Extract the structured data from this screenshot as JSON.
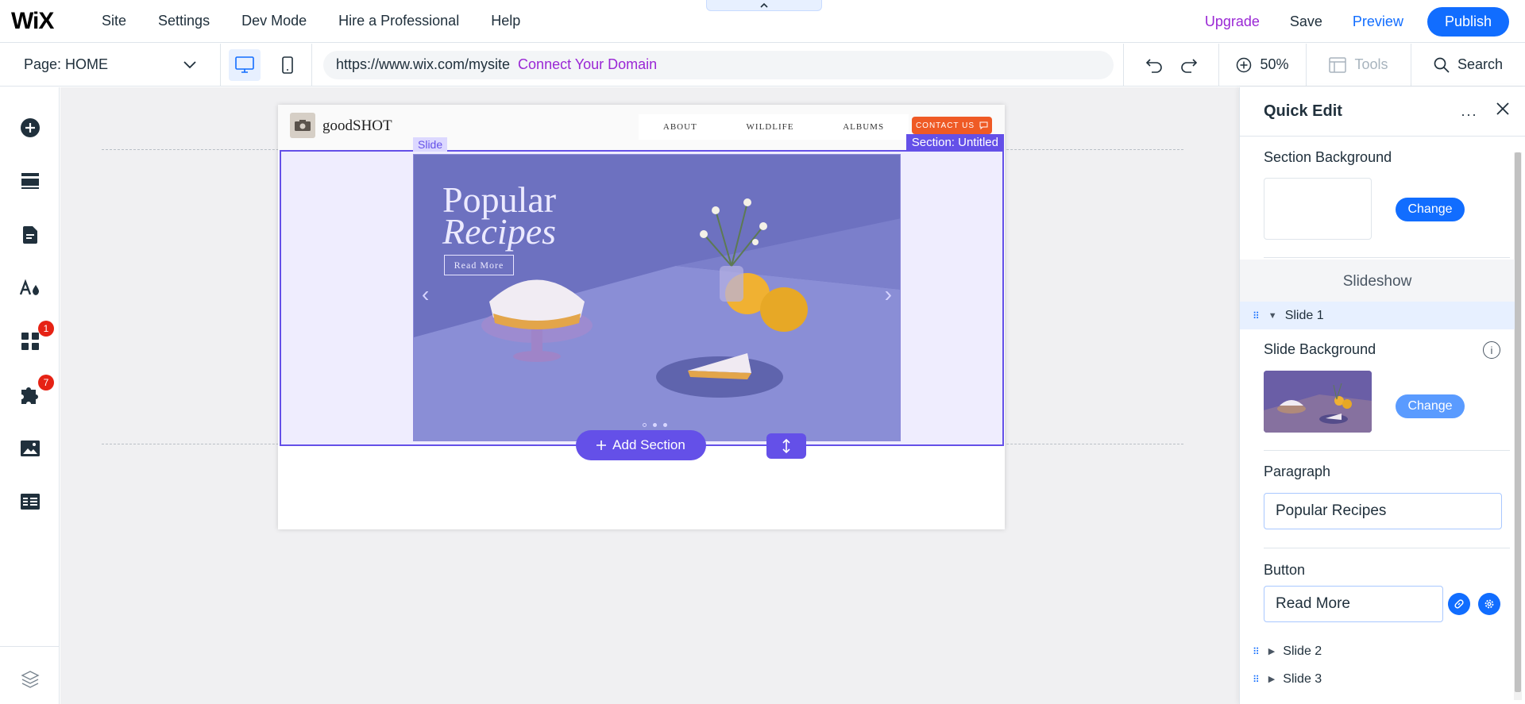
{
  "topbar": {
    "logo": "WiX",
    "menu": [
      "Site",
      "Settings",
      "Dev Mode",
      "Hire a Professional",
      "Help"
    ],
    "upgrade": "Upgrade",
    "save": "Save",
    "preview": "Preview",
    "publish": "Publish"
  },
  "toolbar": {
    "page_label": "Page: HOME",
    "url": "https://www.wix.com/mysite",
    "connect_domain": "Connect Your Domain",
    "zoom": "50%",
    "tools": "Tools",
    "search": "Search"
  },
  "left_rail": {
    "apps_badge": "1",
    "business_badge": "7"
  },
  "site": {
    "brand": "goodSHOT",
    "nav": [
      "ABOUT",
      "WILDLIFE",
      "ALBUMS"
    ],
    "contact": "CONTACT US",
    "section_tag": "Section: Untitled",
    "slide_tag": "Slide",
    "slide_title_line1": "Popular",
    "slide_title_line2": "Recipes",
    "slide_button": "Read More",
    "add_section": "Add Section"
  },
  "panel": {
    "title": "Quick Edit",
    "more": "···",
    "section_background": "Section Background",
    "change": "Change",
    "slideshow": "Slideshow",
    "slide1": "Slide 1",
    "slide_background": "Slide Background",
    "info": "i",
    "paragraph_label": "Paragraph",
    "paragraph_value": "Popular Recipes",
    "button_label": "Button",
    "button_value": "Read More",
    "slide2": "Slide 2",
    "slide3": "Slide 3"
  },
  "colors": {
    "accent_blue": "#116dff",
    "selection_purple": "#6450e8",
    "upgrade_purple": "#9a27d5",
    "badge_red": "#e62214",
    "contact_orange": "#ef5a25",
    "slide_bg": "#7276c4"
  },
  "icons": {
    "add": "plus-circle-icon",
    "sections": "sections-icon",
    "pages": "page-icon",
    "design": "theme-icon",
    "apps": "apps-icon",
    "business": "puzzle-icon",
    "media": "image-icon",
    "cms": "table-icon",
    "layers": "layers-icon"
  }
}
